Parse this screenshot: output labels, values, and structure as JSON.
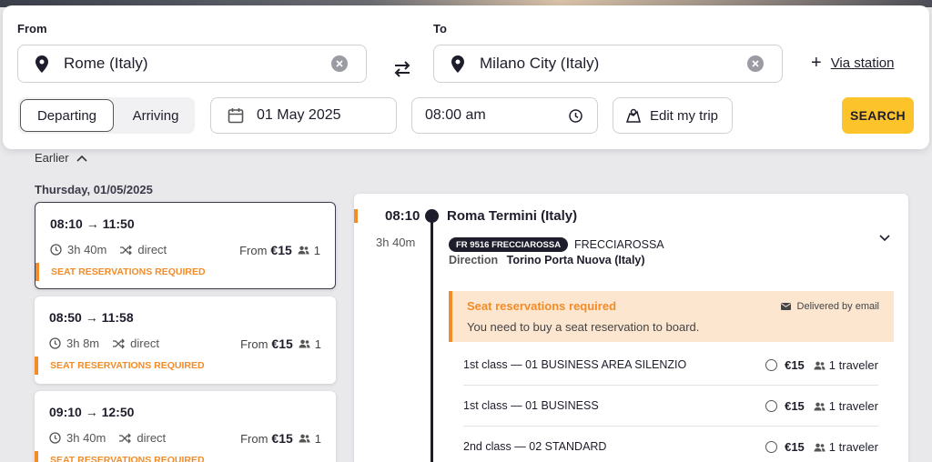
{
  "search": {
    "from_label": "From",
    "from_value": "Rome (Italy)",
    "to_label": "To",
    "to_value": "Milano City (Italy)",
    "via_label": "Via station",
    "departing": "Departing",
    "arriving": "Arriving",
    "date": "01 May 2025",
    "time": "08:00 am",
    "edit_trip": "Edit my trip",
    "search_button": "SEARCH"
  },
  "results": {
    "earlier": "Earlier",
    "day_label": "Thursday, 01/05/2025",
    "journeys": [
      {
        "times": "08:10 → 11:50",
        "duration": "3h 40m",
        "type": "direct",
        "from": "From",
        "price": "€15",
        "travelers": "1",
        "warning": "SEAT RESERVATIONS REQUIRED"
      },
      {
        "times": "08:50 → 11:58",
        "duration": "3h 8m",
        "type": "direct",
        "from": "From",
        "price": "€15",
        "travelers": "1",
        "warning": "SEAT RESERVATIONS REQUIRED"
      },
      {
        "times": "09:10 → 12:50",
        "duration": "3h 40m",
        "type": "direct",
        "from": "From",
        "price": "€15",
        "travelers": "1",
        "warning": "SEAT RESERVATIONS REQUIRED"
      }
    ]
  },
  "detail": {
    "time": "08:10",
    "station": "Roma Termini (Italy)",
    "duration": "3h 40m",
    "train_badge": "FR 9516 FRECCIAROSSA",
    "brand": "FRECCIAROSSA",
    "direction_label": "Direction",
    "direction_value": "Torino Porta Nuova (Italy)",
    "seat_title": "Seat reservations required",
    "seat_text": "You need to buy a seat reservation to board.",
    "delivered": "Delivered by email",
    "fares": [
      {
        "name": "1st class — 01 BUSINESS AREA SILENZIO",
        "price": "€15",
        "travelers": "1 traveler"
      },
      {
        "name": "1st class — 01 BUSINESS",
        "price": "€15",
        "travelers": "1 traveler"
      },
      {
        "name": "2nd class — 02 STANDARD",
        "price": "€15",
        "travelers": "1 traveler"
      }
    ]
  },
  "colors": {
    "accent": "#fdc32b",
    "warning": "#f28c28",
    "dark": "#1d1d2b"
  },
  "icons": [
    "pin-icon",
    "clear-icon",
    "swap-icon",
    "plus-icon",
    "calendar-icon",
    "clock-icon",
    "map-icon",
    "chevron-up-icon",
    "shuffle-icon",
    "people-icon",
    "chevron-down-icon",
    "mail-icon"
  ]
}
